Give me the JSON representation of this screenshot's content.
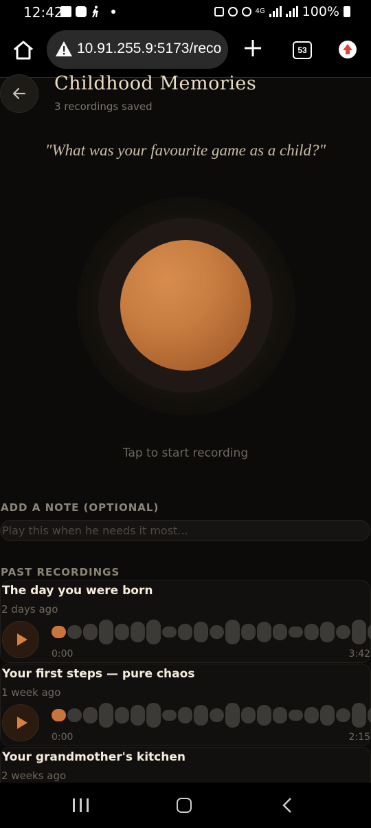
{
  "status_bar": {
    "time": "12:42",
    "network": "4G",
    "battery": "100%"
  },
  "browser": {
    "url": "10.91.255.9:5173/reco",
    "tab_count": "53"
  },
  "header": {
    "title": "Childhood Memories",
    "subtitle": "3 recordings saved"
  },
  "prompt": "\"What was your favourite game as a child?\"",
  "recorder": {
    "hint": "Tap to start recording"
  },
  "note": {
    "label": "ADD A NOTE (OPTIONAL)",
    "placeholder": "Play this when he needs it most...",
    "value": ""
  },
  "recordings_section": {
    "label": "PAST RECORDINGS",
    "items": [
      {
        "title": "The day you were born",
        "date": "2 days ago",
        "current": "0:00",
        "duration": "3:42"
      },
      {
        "title": "Your first steps — pure chaos",
        "date": "1 week ago",
        "current": "0:00",
        "duration": "2:15"
      },
      {
        "title": "Your grandmother's kitchen",
        "date": "2 weeks ago"
      }
    ]
  },
  "colors": {
    "accent": "#c8743a",
    "background": "#0c0b0a",
    "orb": "#c77c40"
  }
}
